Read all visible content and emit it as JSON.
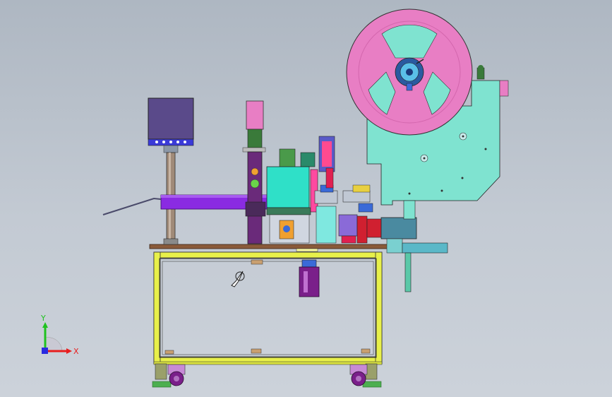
{
  "view": {
    "background_top": "#aeb7c2",
    "background_bottom": "#ccd2da"
  },
  "triad": {
    "x_label": "X",
    "y_label": "Y",
    "x_color": "#e81e1e",
    "y_color": "#1fc21f",
    "z_color": "#2a2ae0"
  },
  "colors": {
    "reel": "#e87ec4",
    "frame_yellow": "#e8f04a",
    "housing_cyan": "#7fe3d0",
    "cyan_block": "#2fe0c8",
    "purple_arm": "#8a2be2",
    "control_box": "#5a4a8a",
    "casters": "#7a1f8a",
    "feet": "#4caf50",
    "base_plate": "#8a5a3a"
  },
  "icons": [
    "cursor-pointer-icon",
    "coordinate-triad-icon"
  ]
}
